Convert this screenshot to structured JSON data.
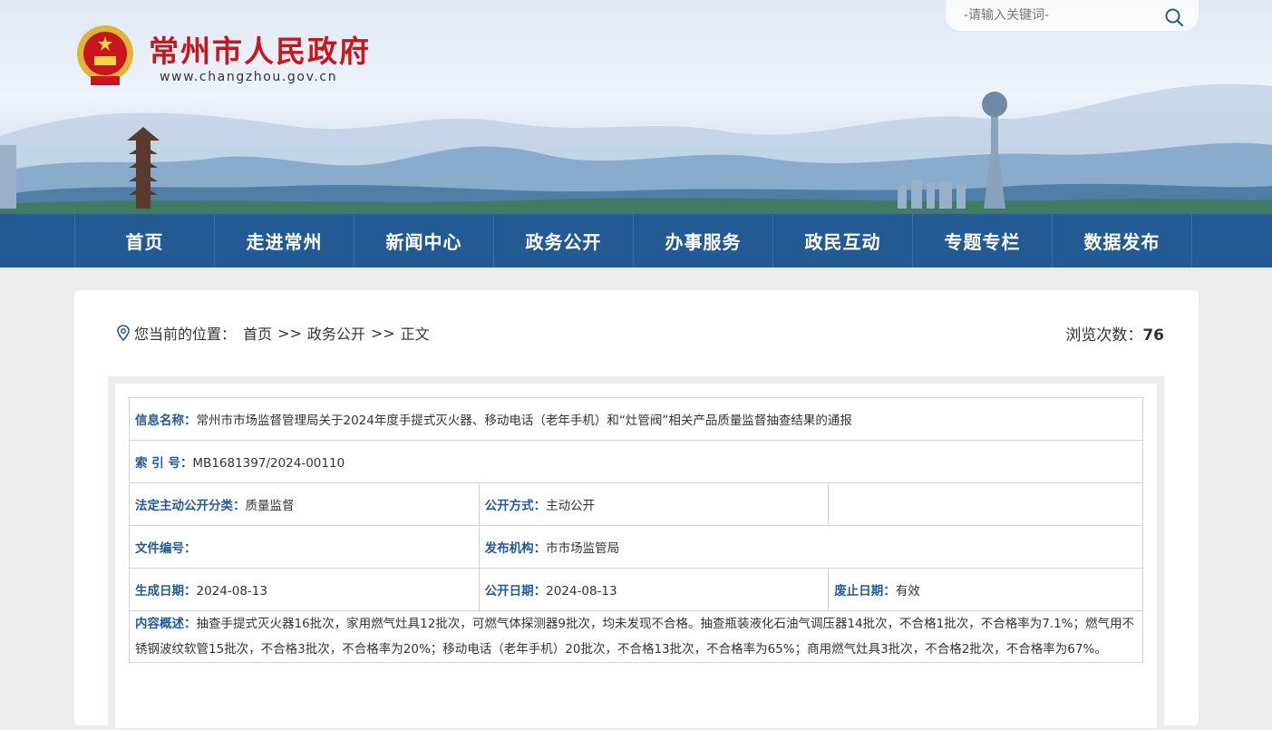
{
  "header": {
    "site_title": "常州市人民政府",
    "site_url": "www.changzhou.gov.cn",
    "search_placeholder": "-请输入关键词-",
    "search_icon": "search-icon",
    "logo_icon": "national-emblem-icon"
  },
  "nav": {
    "items": [
      "首页",
      "走进常州",
      "新闻中心",
      "政务公开",
      "办事服务",
      "政民互动",
      "专题专栏",
      "数据发布"
    ]
  },
  "breadcrumb": {
    "prefix": "您当前的位置：",
    "items": [
      "首页",
      "政务公开",
      "正文"
    ],
    "separator": ">>",
    "pin_icon": "location-pin-icon"
  },
  "views": {
    "label": "浏览次数：",
    "count": "76"
  },
  "info": {
    "title_label": "信息名称：",
    "title_value": "常州市市场监督管理局关于2024年度手提式灭火器、移动电话（老年手机）和“灶管阀”相关产品质量监督抽查结果的通报",
    "index_label": "索 引 号：",
    "index_value": "MB1681397/2024-00110",
    "category_label": "法定主动公开分类：",
    "category_value": "质量监督",
    "open_mode_label": "公开方式：",
    "open_mode_value": "主动公开",
    "doc_no_label": "文件编号：",
    "doc_no_value": "",
    "publisher_label": "发布机构：",
    "publisher_value": "市市场监管局",
    "created_label": "生成日期：",
    "created_value": "2024-08-13",
    "published_label": "公开日期：",
    "published_value": "2024-08-13",
    "expiry_label": "废止日期：",
    "expiry_value": "有效",
    "summary_label": "内容概述：",
    "summary_value": "抽查手提式灭火器16批次，家用燃气灶具12批次，可燃气体探测器9批次，均未发现不合格。抽查瓶装液化石油气调压器14批次，不合格1批次，不合格率为7.1%；燃气用不锈钢波纹软管15批次，不合格3批次，不合格率为20%；移动电话（老年手机）20批次，不合格13批次，不合格率为65%；商用燃气灶具3批次，不合格2批次，不合格率为67%。"
  },
  "colors": {
    "nav_bg": "#235a94",
    "title_red": "#c8161d",
    "label_blue": "#235a94"
  }
}
